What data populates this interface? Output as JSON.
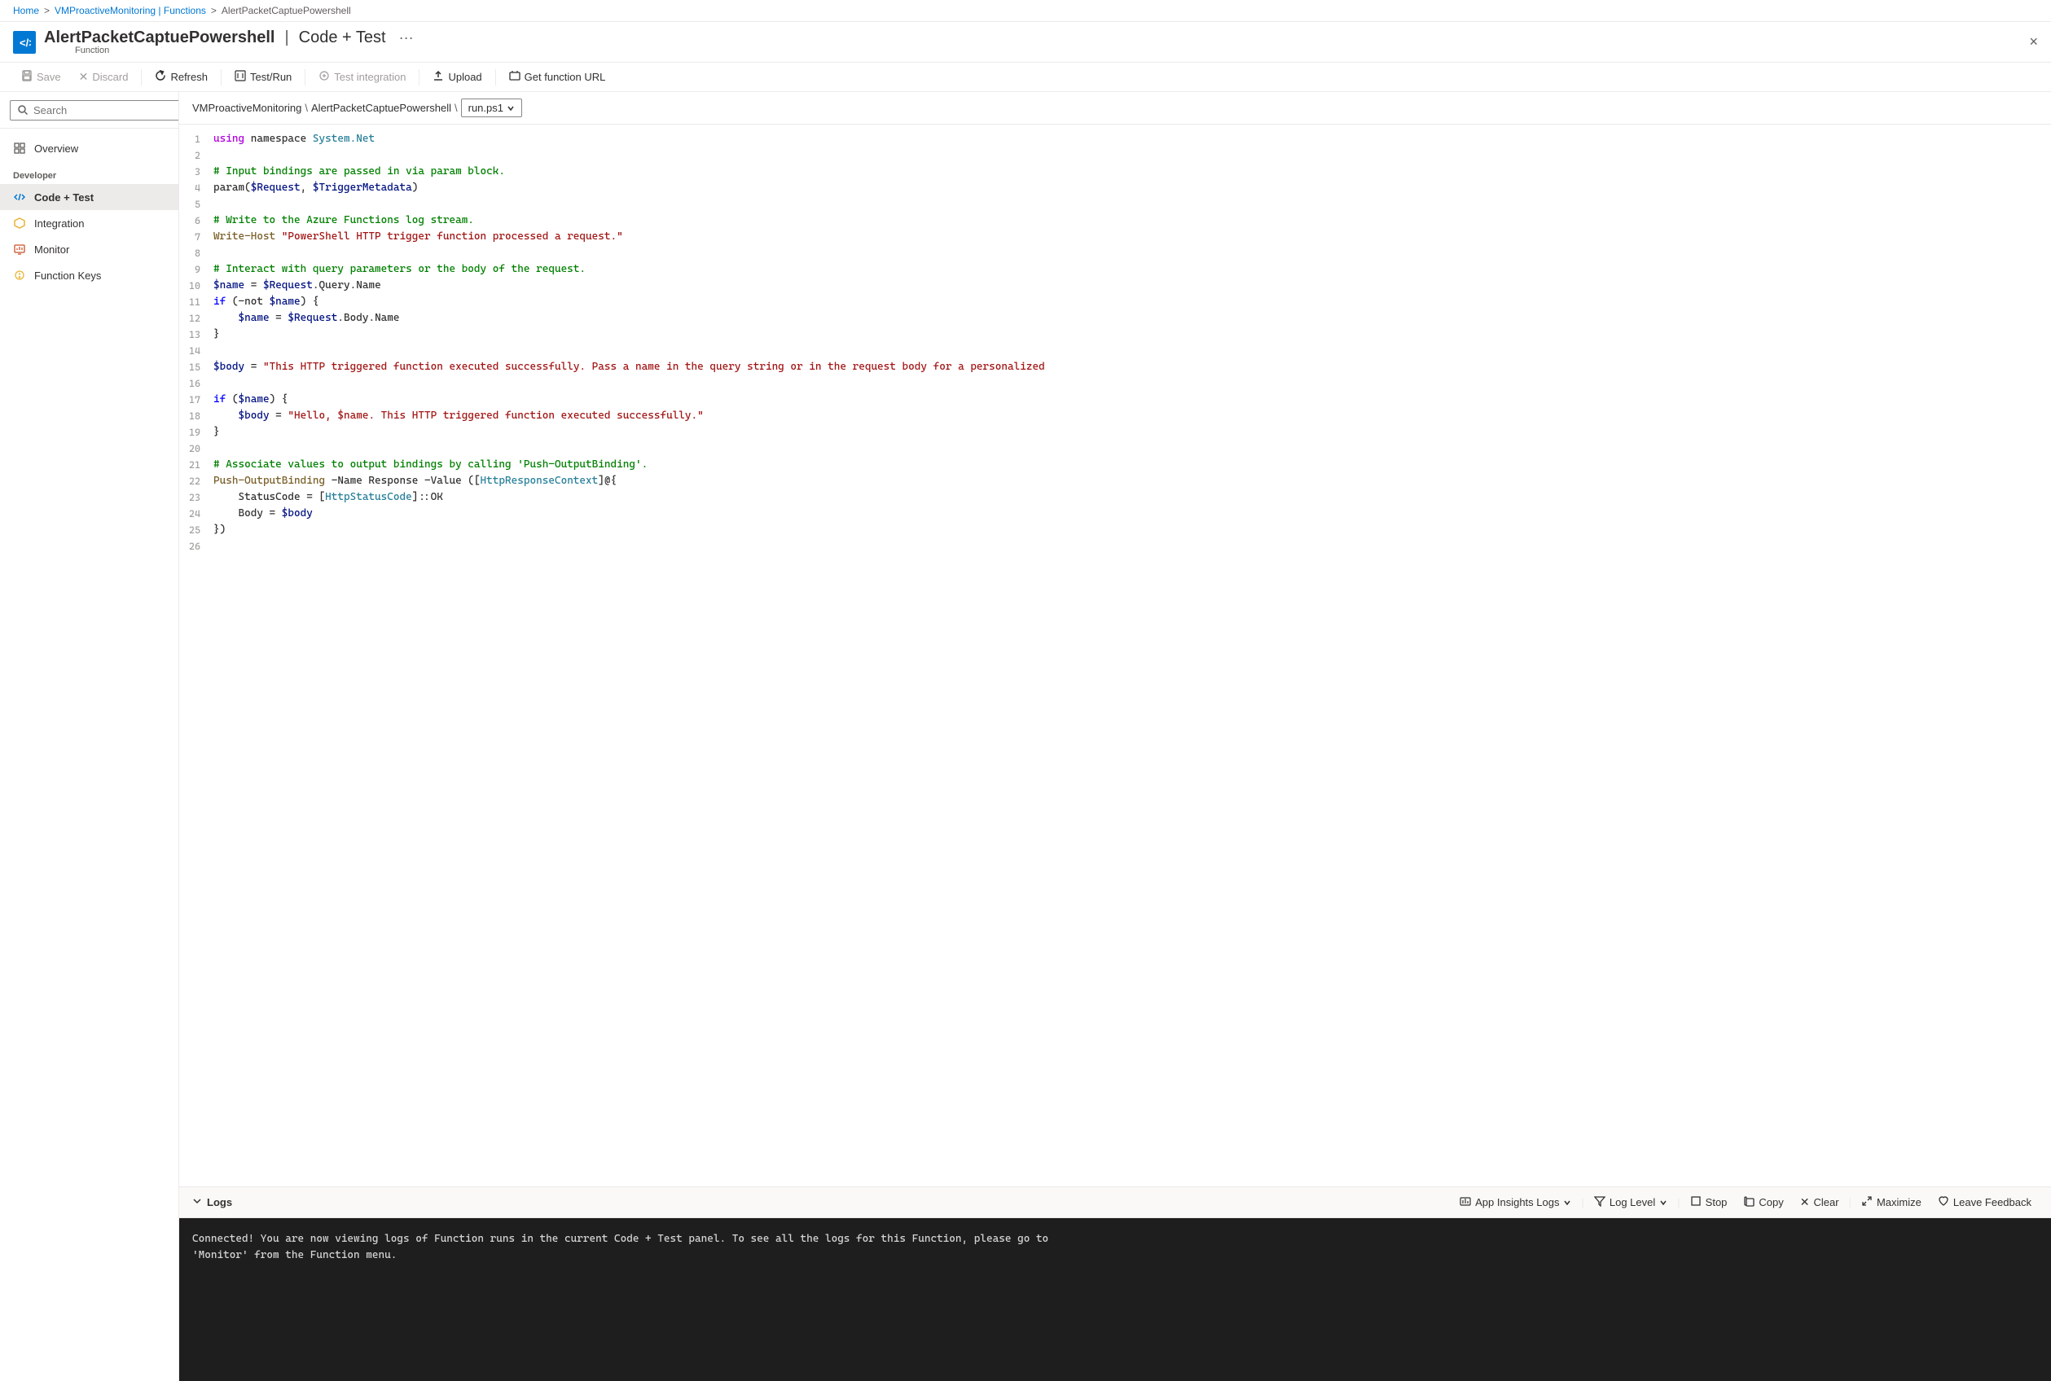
{
  "breadcrumb": {
    "items": [
      "Home",
      "VMProactiveMonitoring | Functions",
      "AlertPacketCaptuePowershell"
    ]
  },
  "header": {
    "title": "AlertPacketCaptuePowershell",
    "separator": "|",
    "subtitle": "Code + Test",
    "dots": "···",
    "function_label": "Function",
    "close_label": "×"
  },
  "toolbar": {
    "save_label": "Save",
    "discard_label": "Discard",
    "refresh_label": "Refresh",
    "test_run_label": "Test/Run",
    "test_integration_label": "Test integration",
    "upload_label": "Upload",
    "get_url_label": "Get function URL"
  },
  "sidebar": {
    "search_placeholder": "Search",
    "overview_label": "Overview",
    "developer_label": "Developer",
    "code_test_label": "Code + Test",
    "integration_label": "Integration",
    "monitor_label": "Monitor",
    "function_keys_label": "Function Keys"
  },
  "file_path": {
    "part1": "VMProactiveMonitoring",
    "sep1": "\\",
    "part2": "AlertPacketCaptuePowershell",
    "sep2": "\\",
    "file_dropdown": "run.ps1"
  },
  "code_lines": [
    {
      "num": 1,
      "content": "using namespace System.Net",
      "tokens": [
        {
          "type": "kw2",
          "text": "using"
        },
        {
          "type": "plain",
          "text": " namespace "
        },
        {
          "type": "type",
          "text": "System.Net"
        }
      ]
    },
    {
      "num": 2,
      "content": ""
    },
    {
      "num": 3,
      "content": "# Input bindings are passed in via param block.",
      "tokens": [
        {
          "type": "cm",
          "text": "# Input bindings are passed in via param block."
        }
      ]
    },
    {
      "num": 4,
      "content": "param($Request, $TriggerMetadata)",
      "tokens": [
        {
          "type": "plain",
          "text": "param("
        },
        {
          "type": "var",
          "text": "$Request"
        },
        {
          "type": "plain",
          "text": ", "
        },
        {
          "type": "var",
          "text": "$TriggerMetadata"
        },
        {
          "type": "plain",
          "text": ")"
        }
      ]
    },
    {
      "num": 5,
      "content": ""
    },
    {
      "num": 6,
      "content": "# Write to the Azure Functions log stream.",
      "tokens": [
        {
          "type": "cm",
          "text": "# Write to the Azure Functions log stream."
        }
      ]
    },
    {
      "num": 7,
      "content": "Write-Host \"PowerShell HTTP trigger function processed a request.\"",
      "tokens": [
        {
          "type": "fn",
          "text": "Write-Host"
        },
        {
          "type": "plain",
          "text": " "
        },
        {
          "type": "str",
          "text": "\"PowerShell HTTP trigger function processed a request.\""
        }
      ]
    },
    {
      "num": 8,
      "content": ""
    },
    {
      "num": 9,
      "content": "# Interact with query parameters or the body of the request.",
      "tokens": [
        {
          "type": "cm",
          "text": "# Interact with query parameters or the body of the request."
        }
      ]
    },
    {
      "num": 10,
      "content": "$name = $Request.Query.Name",
      "tokens": [
        {
          "type": "var",
          "text": "$name"
        },
        {
          "type": "plain",
          "text": " = "
        },
        {
          "type": "var",
          "text": "$Request"
        },
        {
          "type": "plain",
          "text": ".Query.Name"
        }
      ]
    },
    {
      "num": 11,
      "content": "if (-not $name) {",
      "tokens": [
        {
          "type": "kw",
          "text": "if"
        },
        {
          "type": "plain",
          "text": " (-not "
        },
        {
          "type": "var",
          "text": "$name"
        },
        {
          "type": "plain",
          "text": ") {"
        }
      ]
    },
    {
      "num": 12,
      "content": "    $name = $Request.Body.Name",
      "tokens": [
        {
          "type": "plain",
          "text": "    "
        },
        {
          "type": "var",
          "text": "$name"
        },
        {
          "type": "plain",
          "text": " = "
        },
        {
          "type": "var",
          "text": "$Request"
        },
        {
          "type": "plain",
          "text": ".Body.Name"
        }
      ]
    },
    {
      "num": 13,
      "content": "}",
      "tokens": [
        {
          "type": "plain",
          "text": "}"
        }
      ]
    },
    {
      "num": 14,
      "content": ""
    },
    {
      "num": 15,
      "content": "$body = \"This HTTP triggered function executed successfully. Pass a name in the query string or in the request body for a personalized",
      "tokens": [
        {
          "type": "var",
          "text": "$body"
        },
        {
          "type": "plain",
          "text": " = "
        },
        {
          "type": "str",
          "text": "\"This HTTP triggered function executed successfully. Pass a name in the query string or in the request body for a personalized"
        }
      ]
    },
    {
      "num": 16,
      "content": ""
    },
    {
      "num": 17,
      "content": "if ($name) {",
      "tokens": [
        {
          "type": "kw",
          "text": "if"
        },
        {
          "type": "plain",
          "text": " ("
        },
        {
          "type": "var",
          "text": "$name"
        },
        {
          "type": "plain",
          "text": ") {"
        }
      ]
    },
    {
      "num": 18,
      "content": "    $body = \"Hello, $name. This HTTP triggered function executed successfully.\"",
      "tokens": [
        {
          "type": "plain",
          "text": "    "
        },
        {
          "type": "var",
          "text": "$body"
        },
        {
          "type": "plain",
          "text": " = "
        },
        {
          "type": "str",
          "text": "\"Hello, $name. This HTTP triggered function executed successfully.\""
        }
      ]
    },
    {
      "num": 19,
      "content": "}",
      "tokens": [
        {
          "type": "plain",
          "text": "}"
        }
      ]
    },
    {
      "num": 20,
      "content": ""
    },
    {
      "num": 21,
      "content": "# Associate values to output bindings by calling 'Push-OutputBinding'.",
      "tokens": [
        {
          "type": "cm",
          "text": "# Associate values to output bindings by calling 'Push-OutputBinding'."
        }
      ]
    },
    {
      "num": 22,
      "content": "Push-OutputBinding -Name Response -Value ([HttpResponseContext]@{",
      "tokens": [
        {
          "type": "fn",
          "text": "Push-OutputBinding"
        },
        {
          "type": "plain",
          "text": " -Name Response -Value (["
        },
        {
          "type": "type",
          "text": "HttpResponseContext"
        },
        {
          "type": "plain",
          "text": "]@{"
        }
      ]
    },
    {
      "num": 23,
      "content": "    StatusCode = [HttpStatusCode]::OK",
      "tokens": [
        {
          "type": "plain",
          "text": "    StatusCode = ["
        },
        {
          "type": "type",
          "text": "HttpStatusCode"
        },
        {
          "type": "plain",
          "text": "]::OK"
        }
      ]
    },
    {
      "num": 24,
      "content": "    Body = $body",
      "tokens": [
        {
          "type": "plain",
          "text": "    Body = "
        },
        {
          "type": "var",
          "text": "$body"
        }
      ]
    },
    {
      "num": 25,
      "content": "})",
      "tokens": [
        {
          "type": "plain",
          "text": "})"
        }
      ]
    },
    {
      "num": 26,
      "content": ""
    }
  ],
  "logs": {
    "title": "Logs",
    "app_insights_label": "App Insights Logs",
    "log_level_label": "Log Level",
    "stop_label": "Stop",
    "copy_label": "Copy",
    "clear_label": "Clear",
    "maximize_label": "Maximize",
    "leave_feedback_label": "Leave Feedback",
    "log_message": "Connected! You are now viewing logs of Function runs in the current Code + Test panel. To see all the logs for this Function, please go to\n'Monitor' from the Function menu."
  }
}
